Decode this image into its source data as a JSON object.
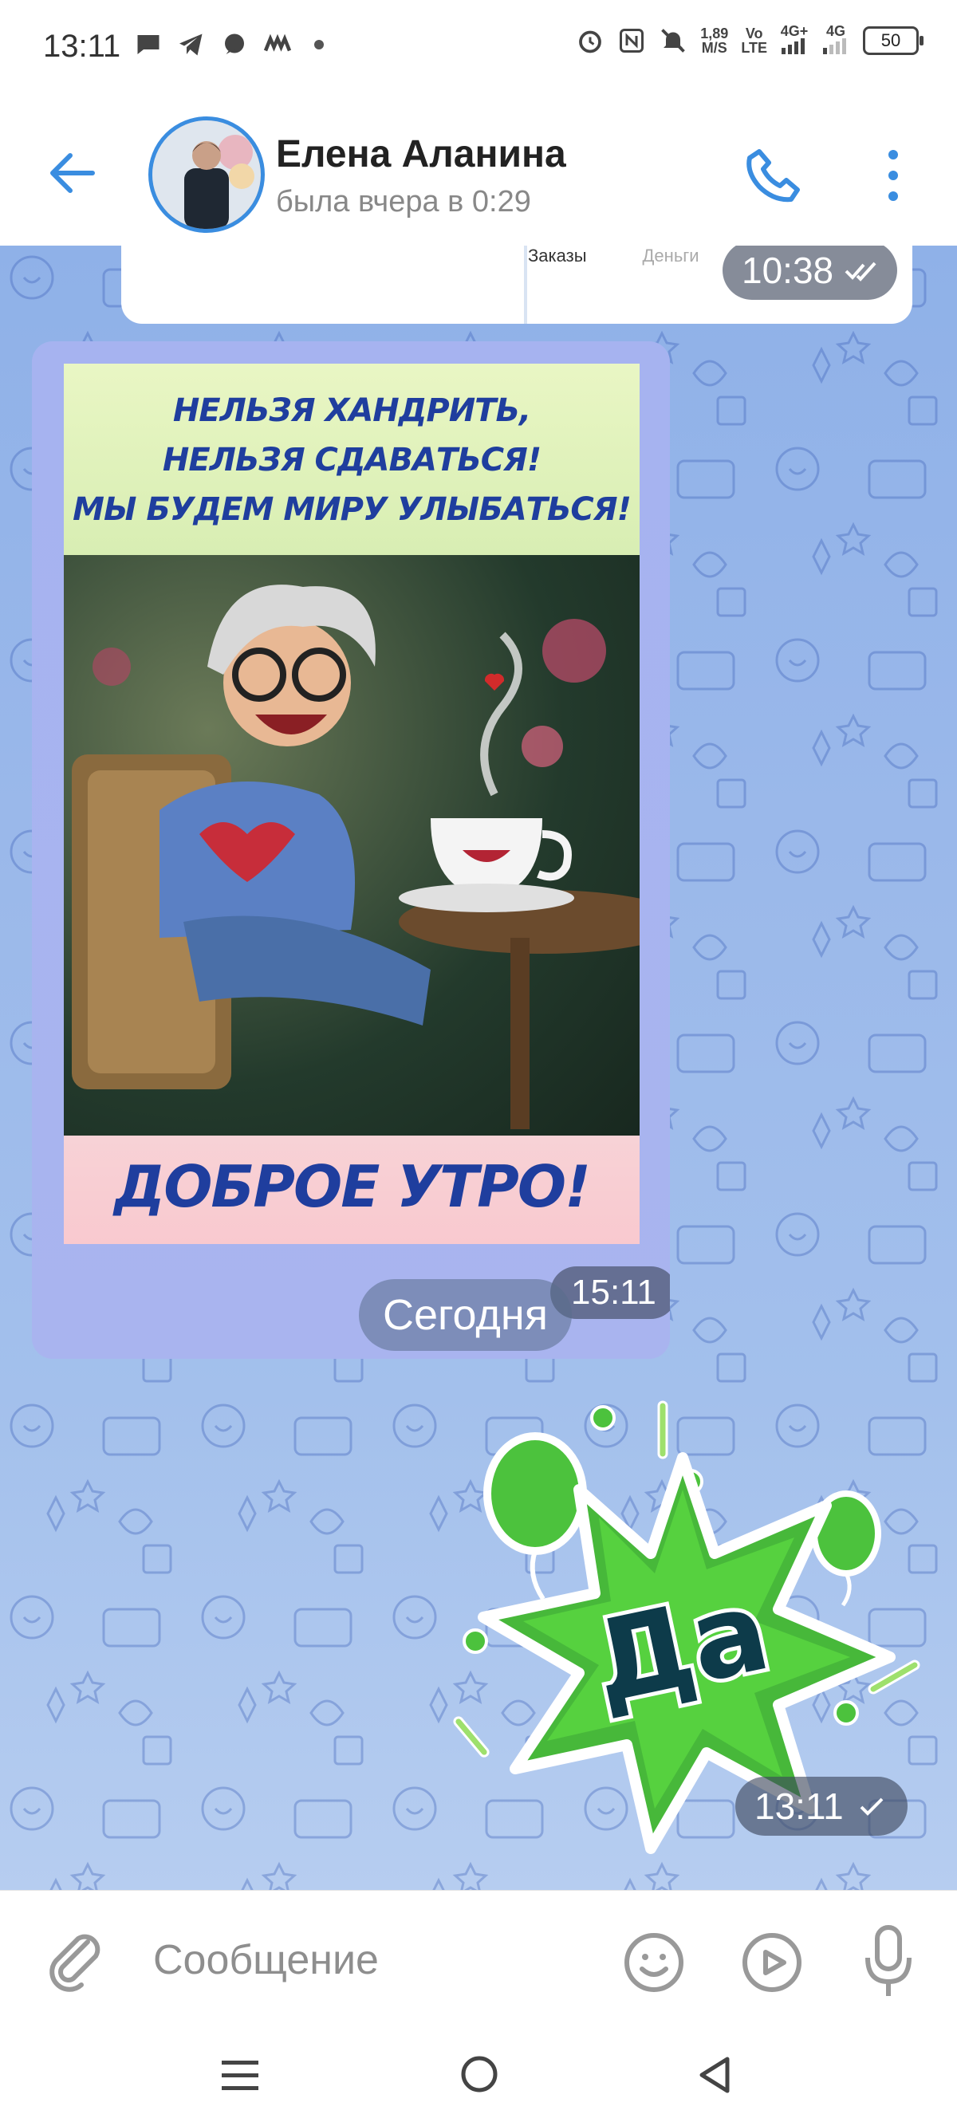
{
  "status_bar": {
    "time": "13:11",
    "net_speed_value": "1,89",
    "net_speed_unit": "M/S",
    "volte_top": "Vo",
    "volte_bottom": "LTE",
    "sig1": "4G+",
    "sig2": "4G",
    "battery": "50"
  },
  "header": {
    "contact_name": "Елена Аланина",
    "contact_status": "была вчера в 0:29"
  },
  "messages": {
    "prev_image": {
      "tab1": "Заказы",
      "tab2": "Деньги",
      "time": "10:38"
    },
    "postcard": {
      "line1": "НЕЛЬЗЯ ХАНДРИТЬ,",
      "line2": "НЕЛЬЗЯ СДАВАТЬСЯ!",
      "line3": "МЫ БУДЕМ МИРУ УЛЫБАТЬСЯ!",
      "bottom": "ДОБРОЕ УТРО!",
      "time": "15:11"
    },
    "date_separator": "Сегодня",
    "sticker": {
      "text": "Да",
      "time": "13:11"
    }
  },
  "composer": {
    "placeholder": "Сообщение"
  },
  "colors": {
    "accent": "#3a8de0",
    "sticker_green": "#49c43a",
    "postcard_text": "#1f3e9e"
  }
}
